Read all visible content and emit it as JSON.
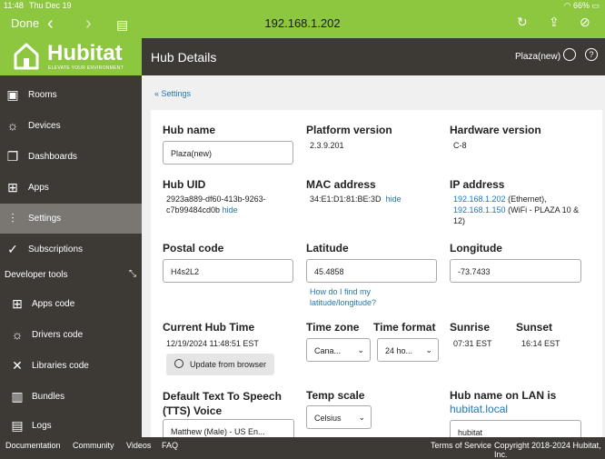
{
  "status_bar": {
    "time": "11:48",
    "date": "Thu Dec 19",
    "battery": "66%"
  },
  "browser": {
    "done": "Done",
    "url": "192.168.1.202"
  },
  "brand": {
    "name": "Hubitat",
    "tagline": "ELEVATE YOUR ENVIRONMENT",
    "color": "#8dc63f"
  },
  "sidebar": {
    "items": [
      {
        "label": "Rooms",
        "icon": "rooms-icon"
      },
      {
        "label": "Devices",
        "icon": "devices-icon"
      },
      {
        "label": "Dashboards",
        "icon": "dashboards-icon"
      },
      {
        "label": "Apps",
        "icon": "apps-icon"
      },
      {
        "label": "Settings",
        "icon": "settings-icon"
      },
      {
        "label": "Subscriptions",
        "icon": "subscriptions-icon"
      }
    ],
    "developer_tools": "Developer tools",
    "dev_items": [
      {
        "label": "Apps code",
        "icon": "apps-code-icon"
      },
      {
        "label": "Drivers code",
        "icon": "drivers-code-icon"
      },
      {
        "label": "Libraries code",
        "icon": "libraries-code-icon"
      },
      {
        "label": "Bundles",
        "icon": "bundles-icon"
      },
      {
        "label": "Logs",
        "icon": "logs-icon"
      }
    ]
  },
  "header": {
    "title": "Hub Details",
    "hub_name": "Plaza(new)"
  },
  "breadcrumb": "« Settings",
  "details": {
    "hub_name_label": "Hub name",
    "hub_name_value": "Plaza(new)",
    "platform_label": "Platform version",
    "platform_value": "2.3.9.201",
    "hardware_label": "Hardware version",
    "hardware_value": "C-8",
    "uid_label": "Hub UID",
    "uid_value_1": "2923a889-df60-413b-9263-",
    "uid_value_2": "c7b99484cd0b",
    "uid_hide": "hide",
    "mac_label": "MAC address",
    "mac_value": "34:E1:D1:81:BE:3D",
    "mac_hide": "hide",
    "ip_label": "IP address",
    "ip_1": "192.168.1.202",
    "ip_1_note": "(Ethernet),",
    "ip_2": "192.168.1.150",
    "ip_2_note": "(WiFi - PLAZA 10 &",
    "ip_2_note2": "12)",
    "postal_label": "Postal code",
    "postal_value": "H4s2L2",
    "lat_label": "Latitude",
    "lat_value": "45.4858",
    "lat_help_1": "How do I find my",
    "lat_help_2": "latitude/longitude?",
    "lon_label": "Longitude",
    "lon_value": "-73.7433",
    "time_label": "Current Hub Time",
    "time_value": "12/19/2024 11:48:51 EST",
    "update_button": "Update from browser",
    "tz_label": "Time zone",
    "tz_value": "Cana...",
    "tf_label": "Time format",
    "tf_value": "24 ho...",
    "sunrise_label": "Sunrise",
    "sunrise_value": "07:31 EST",
    "sunset_label": "Sunset",
    "sunset_value": "16:14 EST",
    "tts_label_1": "Default Text To Speech",
    "tts_label_2": "(TTS) Voice",
    "tts_value": "Matthew (Male) - US En...",
    "temp_label": "Temp scale",
    "temp_value": "Celsius",
    "lan_label": "Hub name on LAN is",
    "lan_link": "hubitat.local",
    "lan_value": "hubitat"
  },
  "footer": {
    "documentation": "Documentation",
    "community": "Community",
    "videos": "Videos",
    "faq": "FAQ",
    "terms": "Terms of Service",
    "copyright": "Copyright 2018-2024 Hubitat, Inc."
  }
}
